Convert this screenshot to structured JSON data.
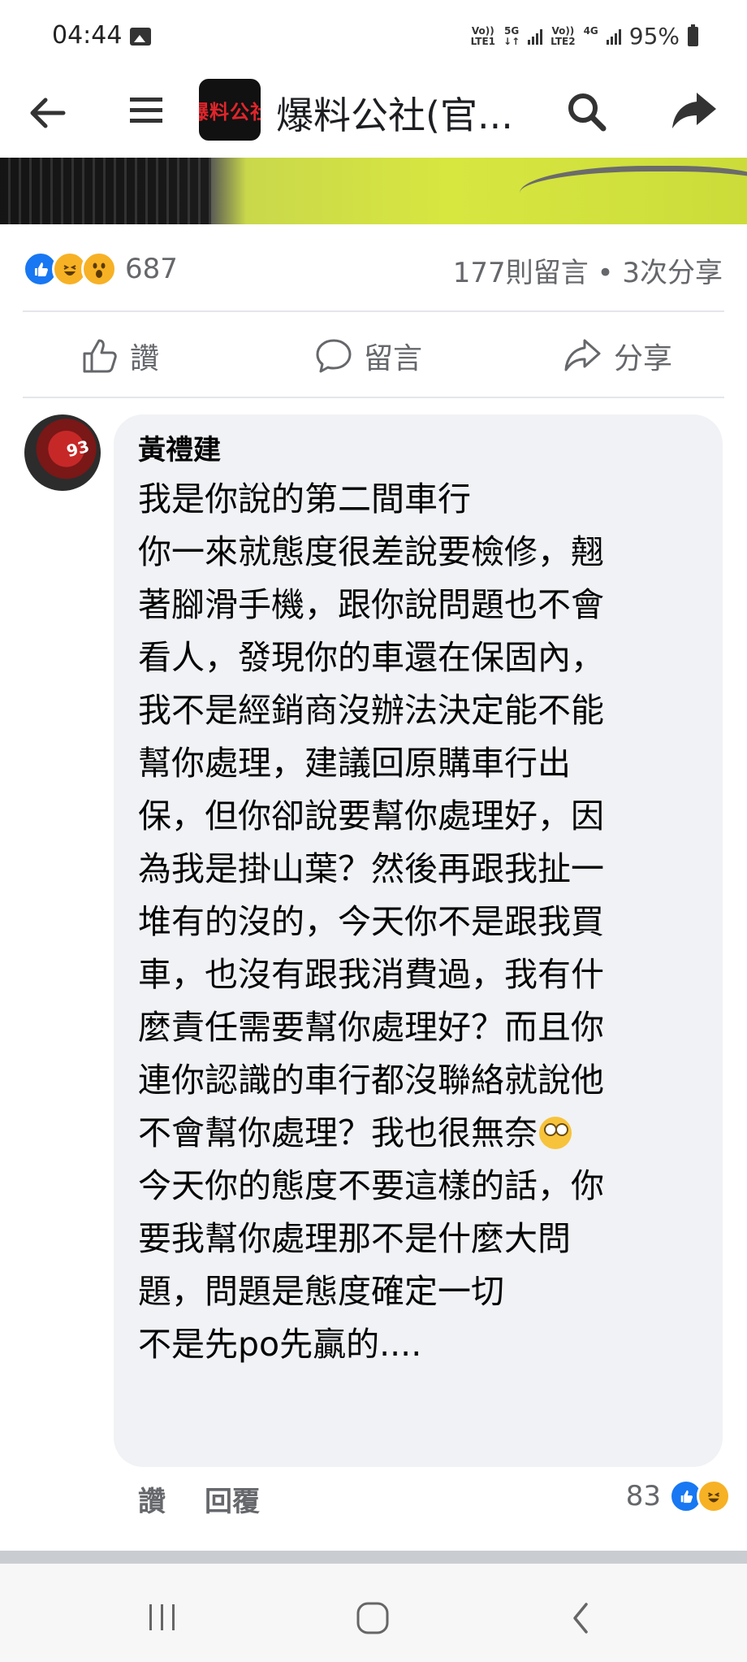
{
  "status_bar": {
    "time": "04:44",
    "network1_top": "Vo))",
    "network1_bottom": "LTE1",
    "network1_type": "5G",
    "network2_top": "Vo))",
    "network2_bottom": "LTE2",
    "network2_type": "4G",
    "battery": "95%"
  },
  "header": {
    "page_name": "爆料公社(官...",
    "logo_text": "爆料公社",
    "icons": [
      "back-arrow-icon",
      "menu-icon",
      "search-icon",
      "share-icon"
    ]
  },
  "post": {
    "reaction_count": "687",
    "comment_share_summary": "177則留言 • 3次分享",
    "actions": {
      "like": "讚",
      "comment": "留言",
      "share": "分享"
    }
  },
  "comment": {
    "author": "黃禮建",
    "avatar_number": "93",
    "lines": [
      "我是你說的第二間車行",
      "你一來就態度很差說要檢修，翹",
      "著腳滑手機，跟你說問題也不會",
      "看人，發現你的車還在保固內，",
      "我不是經銷商沒辦法決定能不能",
      "幫你處理，建議回原購車行出",
      "保，但你卻說要幫你處理好，因",
      "為我是掛山葉？然後再跟我扯一",
      "堆有的沒的，今天你不是跟我買",
      "車，也沒有跟我消費過，我有什",
      "麼責任需要幫你處理好？而且你",
      "連你認識的車行都沒聯絡就說他",
      "不會幫你處理？我也很無奈",
      "今天你的態度不要這樣的話，你",
      "要我幫你處理那不是什麼大問",
      "題，問題是態度確定一切",
      "不是先po先贏的...."
    ],
    "like_label": "讚",
    "reply_label": "回覆",
    "reaction_count": "83"
  },
  "colors": {
    "facebook_blue": "#1877f2",
    "reaction_yellow": "#f7b125",
    "secondary_text": "#65676b",
    "bubble_bg": "#f0f2f5"
  }
}
